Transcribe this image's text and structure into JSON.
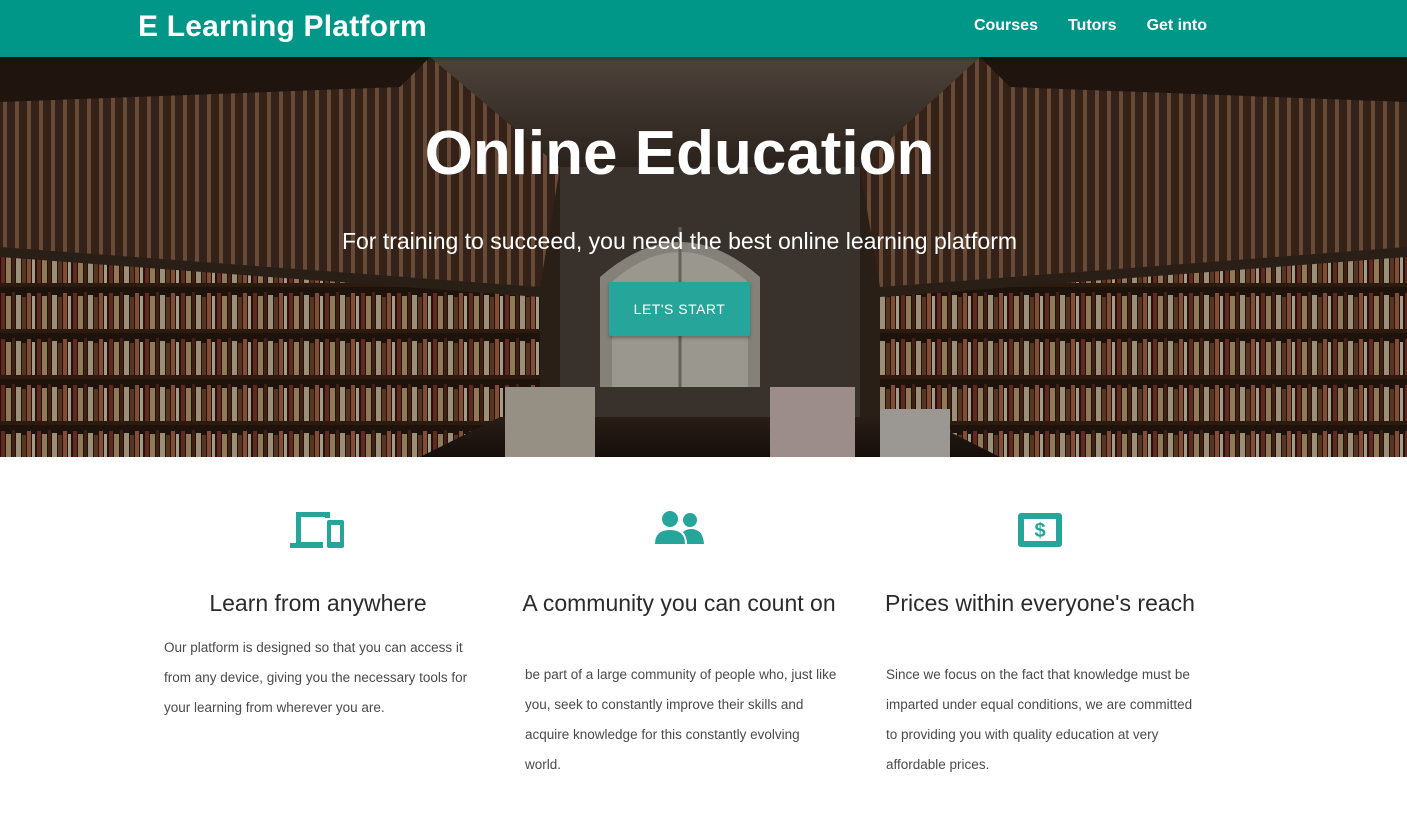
{
  "navbar": {
    "brand": "E Learning Platform",
    "links": [
      {
        "label": "Courses"
      },
      {
        "label": "Tutors"
      },
      {
        "label": "Get into"
      }
    ],
    "color": "#009688"
  },
  "hero": {
    "title": "Online Education",
    "subtitle": "For training to succeed, you need the best online learning platform",
    "button_label": "LET'S START",
    "button_color": "#26a69a"
  },
  "features": [
    {
      "icon": "devices-icon",
      "title": "Learn from anywhere",
      "text": "Our platform is designed so that you can access it from any device, giving you the necessary tools for your learning from wherever you are."
    },
    {
      "icon": "people-icon",
      "title": "A community you can count on",
      "text": "be part of a large community of people who, just like you, seek to constantly improve their skills and acquire knowledge for this constantly evolving world."
    },
    {
      "icon": "dollar-bill-icon",
      "title": "Prices within everyone's reach",
      "text": "Since we focus on the fact that knowledge must be imparted under equal conditions, we are committed to providing you with quality education at very affordable prices."
    }
  ],
  "accent_color": "#26a69a"
}
